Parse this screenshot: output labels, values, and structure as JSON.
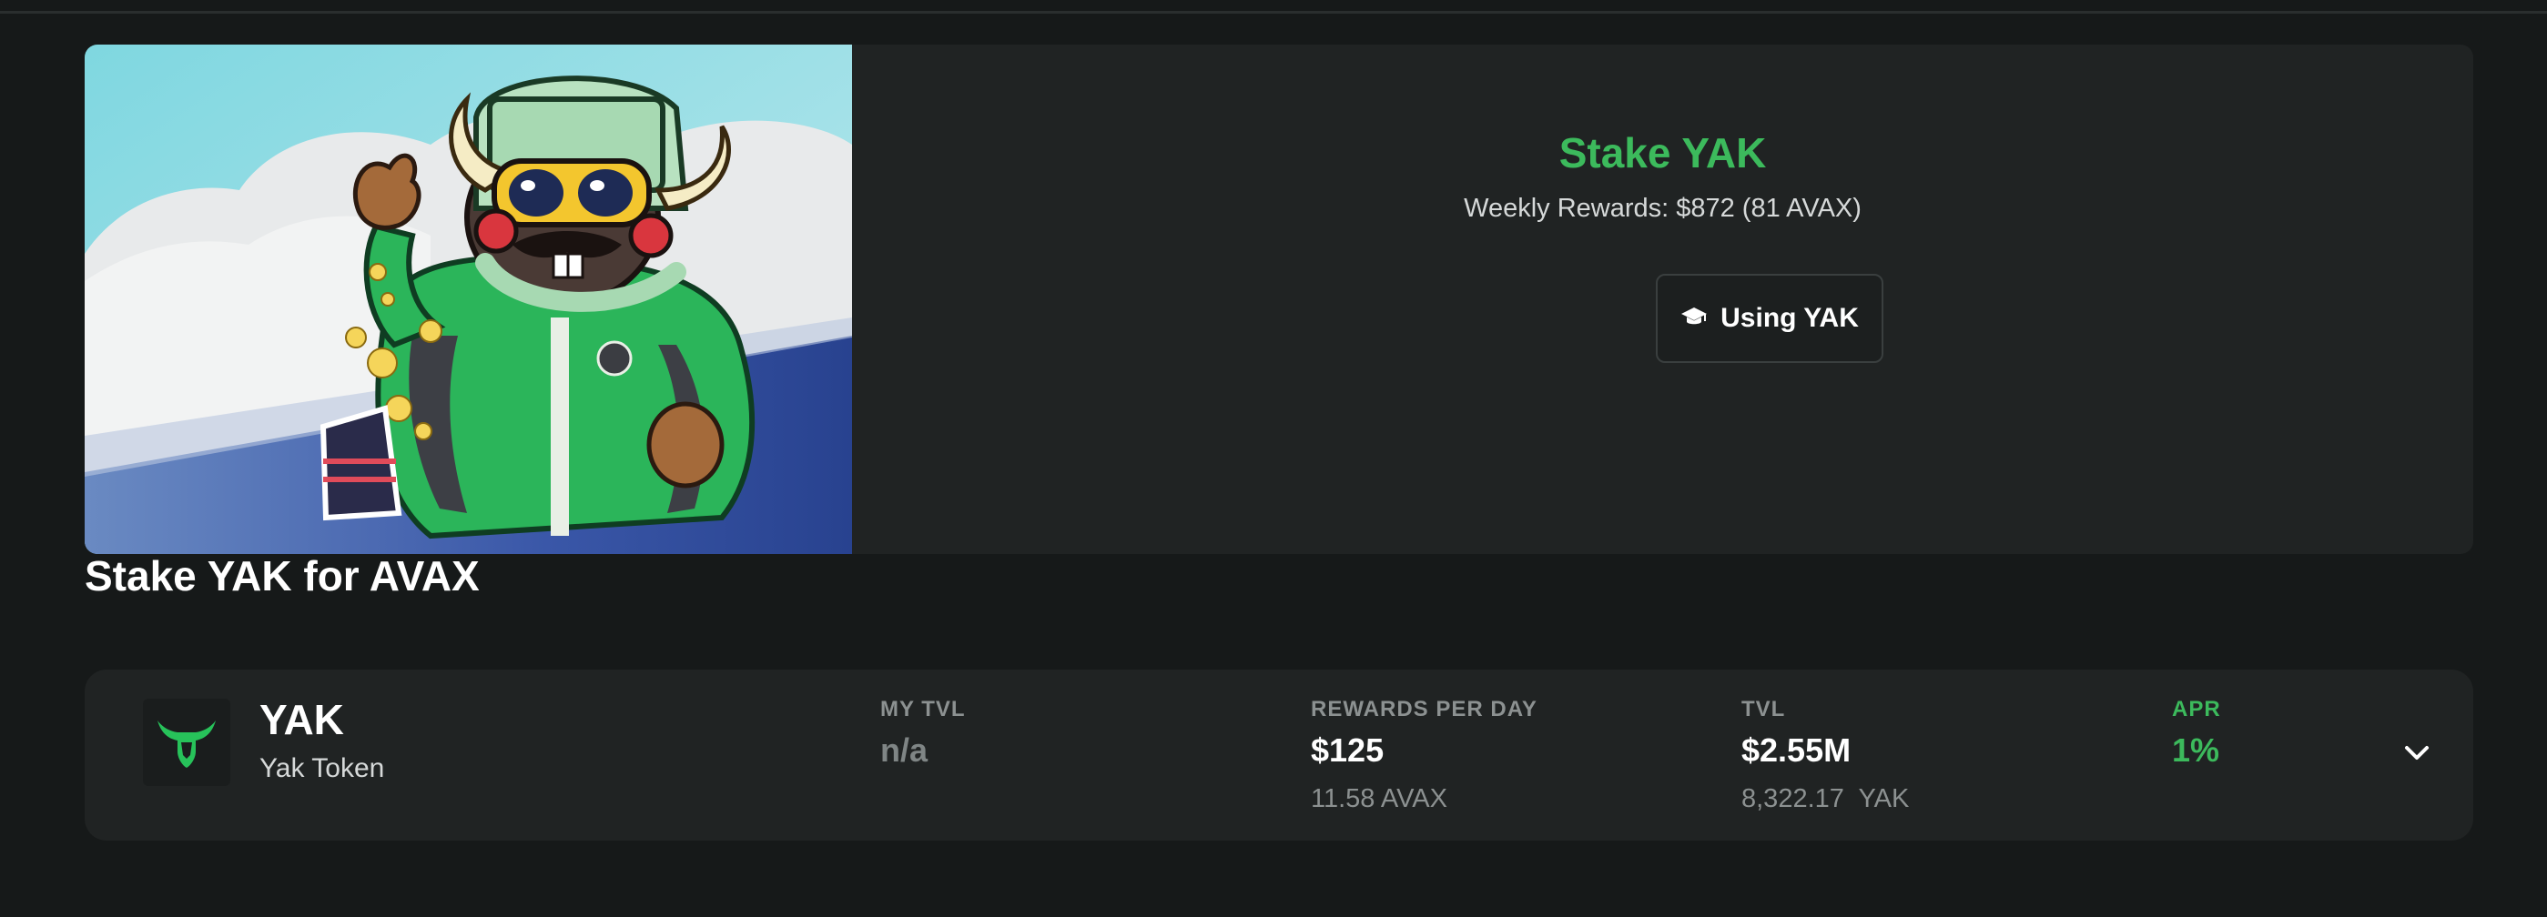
{
  "hero": {
    "title": "Stake YAK",
    "weekly_rewards": "Weekly Rewards: $872 (81 AVAX)",
    "using_button_label": "Using YAK",
    "title_color": "#3cba5c"
  },
  "section": {
    "title": "Stake YAK for AVAX"
  },
  "pool": {
    "token_symbol": "YAK",
    "token_name": "Yak Token",
    "my_tvl": {
      "label": "MY TVL",
      "value": "n/a"
    },
    "rewards_per_day": {
      "label": "REWARDS PER DAY",
      "value": "$125",
      "sub": "11.58 AVAX"
    },
    "tvl": {
      "label": "TVL",
      "value": "$2.55M",
      "sub": "8,322.17  YAK"
    },
    "apr": {
      "label": "APR",
      "value": "1%"
    },
    "expand_icon": "chevron-down-icon"
  },
  "icons": {
    "button_icon": "graduation-cap-icon",
    "token_logo": "yak-horns-logo"
  },
  "colors": {
    "background": "#161919",
    "card": "#202323",
    "accent_green": "#3cba5c",
    "muted_text": "#8c9191"
  }
}
